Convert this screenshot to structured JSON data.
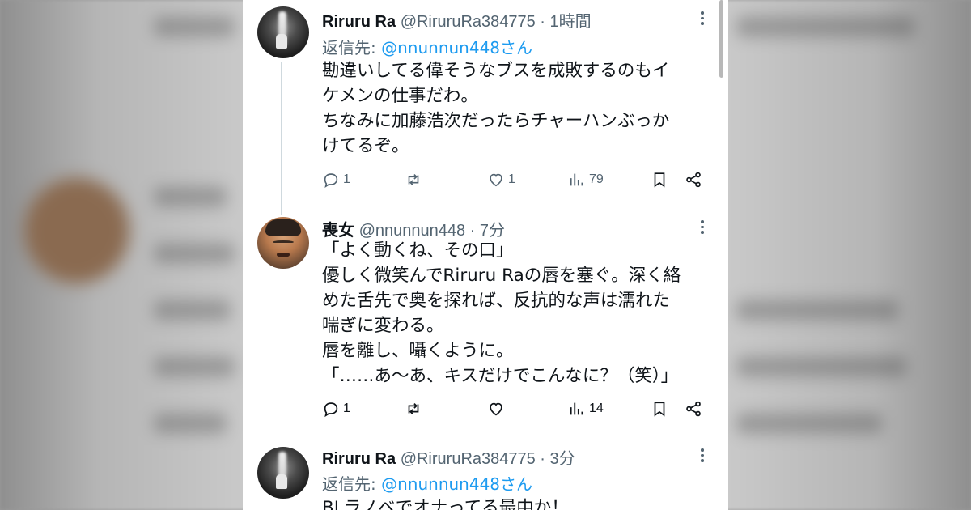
{
  "tweets": [
    {
      "name": "Riruru Ra",
      "handle": "@RiruruRa384775",
      "time": "1時間",
      "reply_prefix": "返信先: ",
      "reply_handle": "@nnunnun448さん",
      "lines": [
        "勘違いしてる偉そうなブスを成敗するのもイ",
        "ケメンの仕事だわ。",
        "ちなみに加藤浩次だったらチャーハンぶっか",
        "けてるぞ。"
      ],
      "replies": "1",
      "retweets": "",
      "likes": "1",
      "views": "79"
    },
    {
      "name": "喪女",
      "handle": "@nnunnun448",
      "time": "7分",
      "lines": [
        "「よく動くね、その口」",
        "優しく微笑んでRiruru Raの唇を塞ぐ。深く絡",
        "めた舌先で奥を探れば、反抗的な声は濡れた",
        "喘ぎに変わる。",
        "唇を離し、囁くように。",
        "「……あ〜あ、キスだけでこんなに？（笑）」"
      ],
      "replies": "1",
      "retweets": "",
      "likes": "",
      "views": "14"
    },
    {
      "name": "Riruru Ra",
      "handle": "@RiruruRa384775",
      "time": "3分",
      "reply_prefix": "返信先: ",
      "reply_handle": "@nnunnun448さん",
      "lines": [
        "BLラノベでオナってる最中か！"
      ]
    }
  ],
  "separator": " · ",
  "icons": {
    "reply": "speech-bubble-icon",
    "retweet": "retweet-arrows-icon",
    "like": "heart-icon",
    "views": "bar-chart-icon",
    "bookmark": "bookmark-icon",
    "share": "share-nodes-icon",
    "more": "vertical-ellipsis-icon"
  },
  "colors": {
    "link": "#1d9bf0",
    "text": "#0f1419",
    "secondary": "#536471",
    "thread_line": "#cfd9de"
  }
}
